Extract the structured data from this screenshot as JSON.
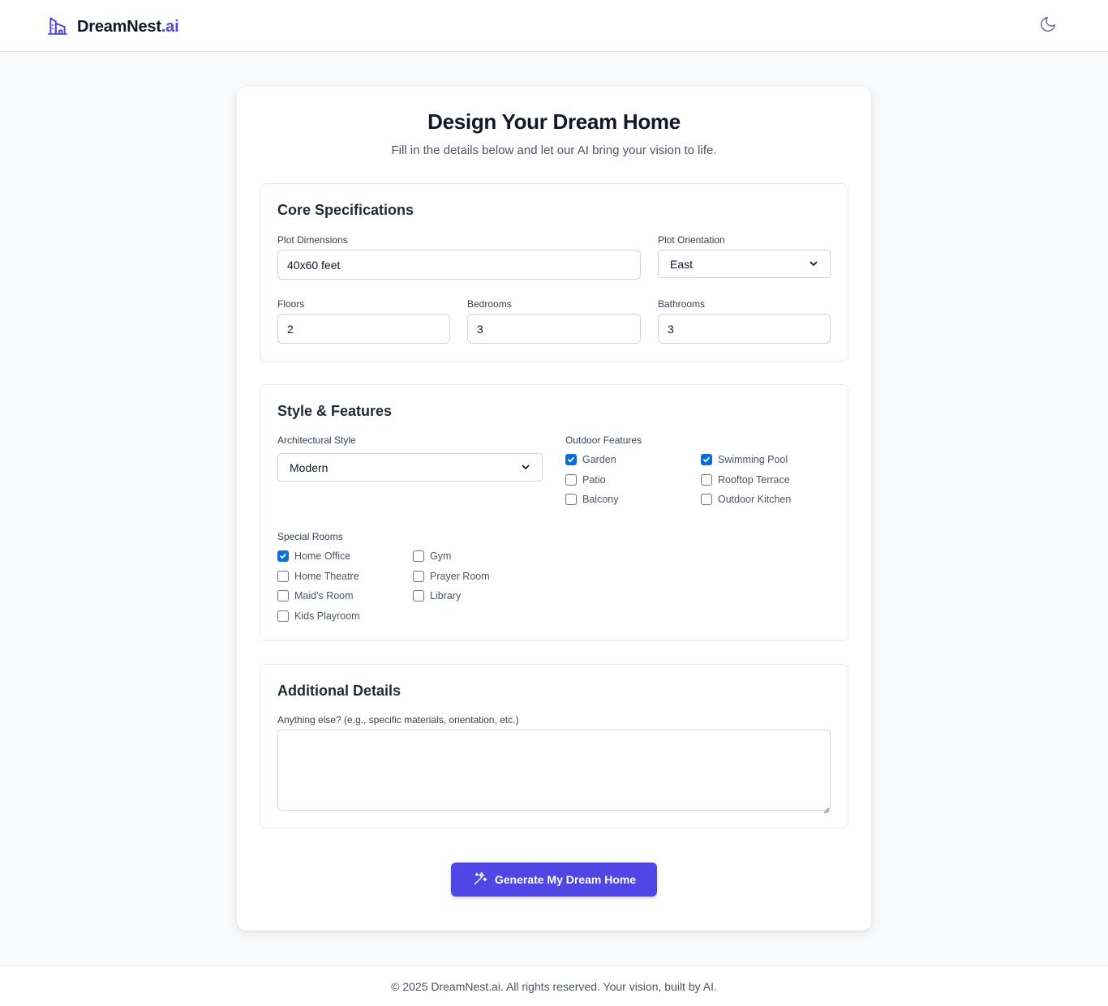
{
  "header": {
    "logo_main": "DreamNest",
    "logo_accent": ".ai",
    "theme_toggle_icon": "moon-icon"
  },
  "colors": {
    "accent": "#4f46e5",
    "checkbox_checked": "#0b6ed8",
    "page_background": "#f9fafb"
  },
  "main": {
    "title": "Design Your Dream Home",
    "subtitle": "Fill in the details below and let our AI bring your vision to life."
  },
  "core": {
    "title": "Core Specifications",
    "plot_dimensions": {
      "label": "Plot Dimensions",
      "value": "40x60 feet"
    },
    "plot_orientation": {
      "label": "Plot Orientation",
      "value": "East"
    },
    "floors": {
      "label": "Floors",
      "value": "2"
    },
    "bedrooms": {
      "label": "Bedrooms",
      "value": "3"
    },
    "bathrooms": {
      "label": "Bathrooms",
      "value": "3"
    }
  },
  "style": {
    "title": "Style & Features",
    "architectural_style": {
      "label": "Architectural Style",
      "value": "Modern"
    },
    "outdoor_label": "Outdoor Features",
    "outdoor": [
      {
        "label": "Garden",
        "checked": true
      },
      {
        "label": "Swimming Pool",
        "checked": true
      },
      {
        "label": "Patio",
        "checked": false
      },
      {
        "label": "Rooftop Terrace",
        "checked": false
      },
      {
        "label": "Balcony",
        "checked": false
      },
      {
        "label": "Outdoor Kitchen",
        "checked": false
      }
    ],
    "special_label": "Special Rooms",
    "special": [
      {
        "label": "Home Office",
        "checked": true
      },
      {
        "label": "Gym",
        "checked": false
      },
      {
        "label": "Home Theatre",
        "checked": false
      },
      {
        "label": "Prayer Room",
        "checked": false
      },
      {
        "label": "Maid's Room",
        "checked": false
      },
      {
        "label": "Library",
        "checked": false
      },
      {
        "label": "Kids Playroom",
        "checked": false
      }
    ]
  },
  "additional": {
    "title": "Additional Details",
    "label": "Anything else? (e.g., specific materials, orientation, etc.)",
    "value": ""
  },
  "generate": {
    "label": "Generate My Dream Home",
    "icon": "sparkles-icon"
  },
  "footer": {
    "text": "© 2025 DreamNest.ai. All rights reserved. Your vision, built by AI."
  }
}
